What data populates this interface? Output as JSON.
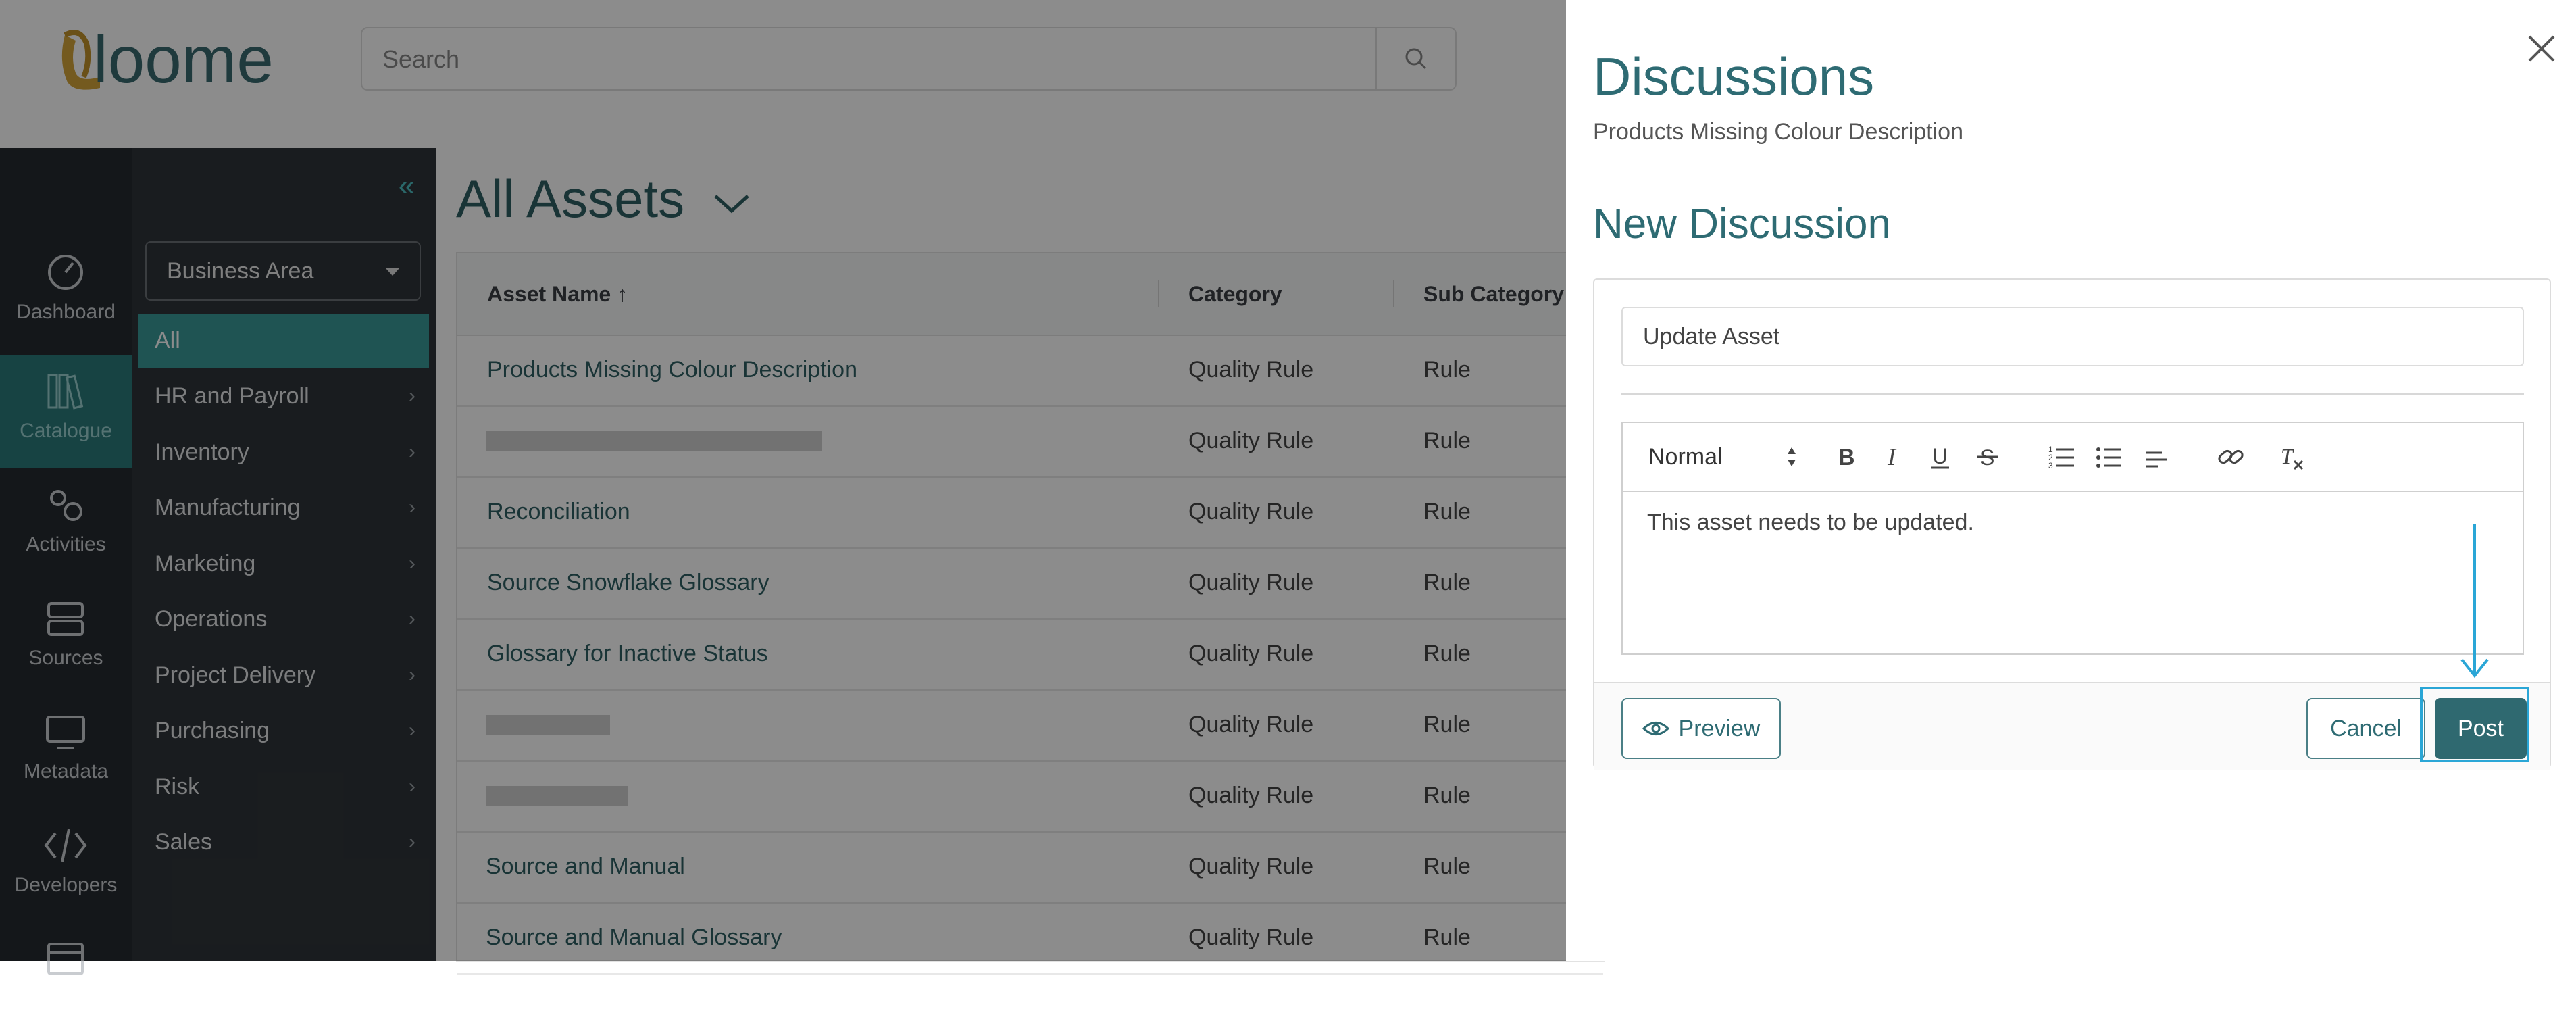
{
  "app": {
    "logo_text": "loome",
    "search_placeholder": "Search"
  },
  "icon_nav": [
    {
      "label": "Dashboard",
      "icon": "dashboard-icon"
    },
    {
      "label": "Catalogue",
      "icon": "catalogue-icon",
      "active": true
    },
    {
      "label": "Activities",
      "icon": "gears-icon"
    },
    {
      "label": "Sources",
      "icon": "sources-icon"
    },
    {
      "label": "Metadata",
      "icon": "metadata-icon"
    },
    {
      "label": "Developers",
      "icon": "code-icon"
    }
  ],
  "area_panel": {
    "selector_label": "Business Area",
    "items": [
      {
        "label": "All",
        "active": true
      },
      {
        "label": "HR and Payroll"
      },
      {
        "label": "Inventory"
      },
      {
        "label": "Manufacturing"
      },
      {
        "label": "Marketing"
      },
      {
        "label": "Operations"
      },
      {
        "label": "Project Delivery"
      },
      {
        "label": "Purchasing"
      },
      {
        "label": "Risk"
      },
      {
        "label": "Sales"
      }
    ]
  },
  "main": {
    "title": "All Assets",
    "columns": [
      "Asset Name",
      "Category",
      "Sub Category"
    ],
    "rows": [
      {
        "name": "Products Missing Colour Description",
        "category": "Quality Rule",
        "sub": "Rule"
      },
      {
        "name": "",
        "category": "Quality Rule",
        "sub": "Rule"
      },
      {
        "name": "Reconciliation",
        "category": "Quality Rule",
        "sub": "Rule"
      },
      {
        "name": "Source Snowflake Glossary",
        "category": "Quality Rule",
        "sub": "Rule"
      },
      {
        "name": "Glossary for Inactive Status",
        "category": "Quality Rule",
        "sub": "Rule"
      },
      {
        "name": "",
        "category": "Quality Rule",
        "sub": "Rule"
      },
      {
        "name": "",
        "category": "Quality Rule",
        "sub": "Rule"
      },
      {
        "name": "Source and Manual",
        "category": "Quality Rule",
        "sub": "Rule"
      },
      {
        "name": "Source and Manual Glossary",
        "category": "Quality Rule",
        "sub": "Rule"
      }
    ]
  },
  "drawer": {
    "title": "Discussions",
    "subtitle": "Products Missing Colour Description",
    "new_title": "New Discussion",
    "title_input_value": "Update Asset",
    "format_select": "Normal",
    "body_text": "This asset needs to be updated.",
    "preview_label": "Preview",
    "cancel_label": "Cancel",
    "post_label": "Post"
  },
  "colors": {
    "accent": "#2f6970",
    "highlight": "#2aa6d6",
    "sidebar": "#262a30"
  }
}
